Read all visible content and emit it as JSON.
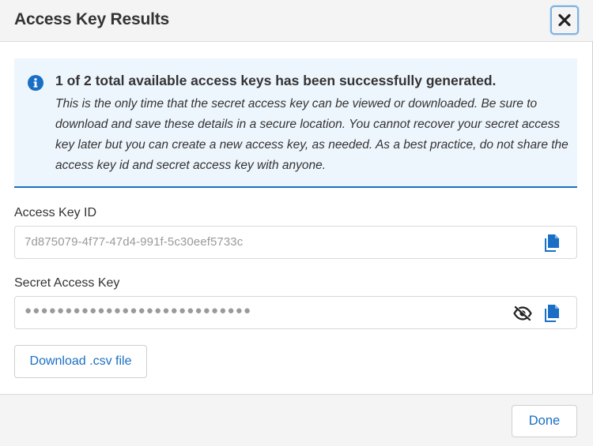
{
  "dialog": {
    "title": "Access Key Results",
    "close_icon": "close-icon"
  },
  "alert": {
    "icon": "info-icon",
    "heading": "1 of 2 total available access keys has been successfully generated.",
    "body": "This is the only time that the secret access key can be viewed or downloaded. Be sure to download and save these details in a secure location. You cannot recover your secret access key later but you can create a new access key, as needed. As a best practice, do not share the access key id and secret access key with anyone.",
    "accent_color": "#1a6fc4",
    "background_color": "#eef6fd"
  },
  "access_key_id": {
    "label": "Access Key ID",
    "value": "7d875079-4f77-47d4-991f-5c30eef5733c",
    "copy_icon": "copy-icon"
  },
  "secret_access_key": {
    "label": "Secret Access Key",
    "masked_value": "●●●●●●●●●●●●●●●●●●●●●●●●●●●●",
    "visibility_icon": "eye-slash-icon",
    "copy_icon": "copy-icon"
  },
  "actions": {
    "download_label": "Download .csv file",
    "done_label": "Done"
  },
  "colors": {
    "primary": "#1a6fc4",
    "text": "#333333",
    "muted": "#9a9a9a"
  }
}
